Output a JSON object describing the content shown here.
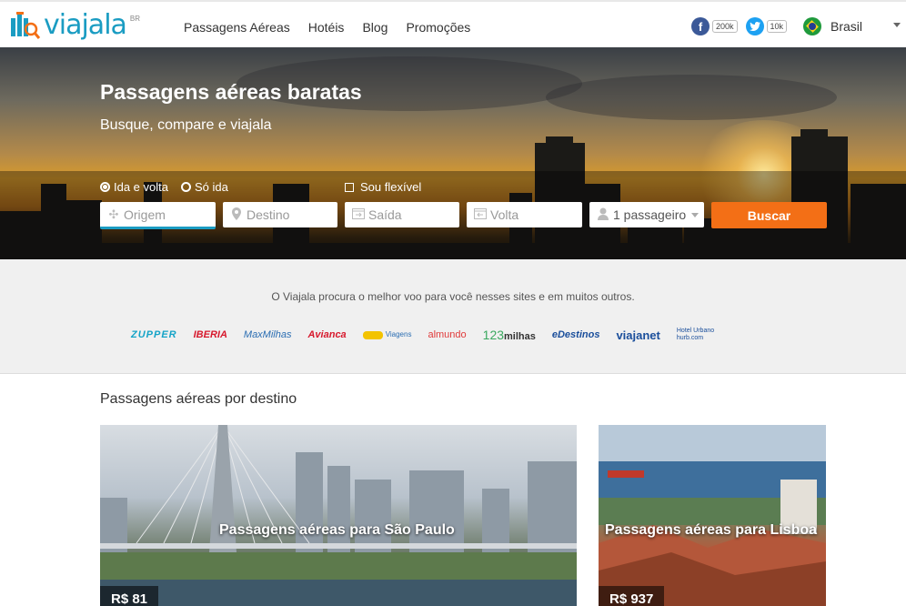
{
  "header": {
    "logo_text": "viajala",
    "logo_sup": "BR",
    "nav": [
      "Passagens Aéreas",
      "Hotéis",
      "Blog",
      "Promoções"
    ],
    "social": {
      "facebook_count": "200k",
      "twitter_count": "10k"
    },
    "country": "Brasil"
  },
  "hero": {
    "title": "Passagens aéreas baratas",
    "subtitle": "Busque, compare e viajala",
    "trip_options": [
      "Ida e volta",
      "Só ida"
    ],
    "selected_trip": "Ida e volta",
    "flexible_label": "Sou flexível",
    "fields": {
      "origin_placeholder": "Origem",
      "destination_placeholder": "Destino",
      "departure_placeholder": "Saída",
      "return_placeholder": "Volta",
      "passengers_value": "1 passageiro"
    },
    "search_button": "Buscar"
  },
  "partners": {
    "text": "O Viajala procura o melhor voo para você nesses sites e em muitos outros.",
    "logos": [
      "ZUPPER",
      "IBERIA",
      "MaxMilhas",
      "Avianca",
      "Viagens",
      "almundo",
      "123",
      "milhas",
      "eDestinos",
      "viajanet",
      "Hotel Urbano",
      "hurb.com"
    ]
  },
  "destinations": {
    "heading": "Passagens aéreas por destino",
    "cards": [
      {
        "title": "Passagens aéreas para São Paulo",
        "price": "R$ 81"
      },
      {
        "title": "Passagens aéreas para Lisboa",
        "price": "R$ 937"
      }
    ]
  },
  "colors": {
    "brand": "#1a9cc2",
    "accent": "#f36f16"
  },
  "icons": {
    "logo": "suitcase-magnifier-icon",
    "facebook": "facebook-icon",
    "twitter": "twitter-icon",
    "flag": "brazil-flag-icon",
    "origin": "crosshair-icon",
    "destination": "map-pin-icon",
    "departure": "calendar-depart-icon",
    "return": "calendar-return-icon",
    "passenger": "user-icon"
  }
}
